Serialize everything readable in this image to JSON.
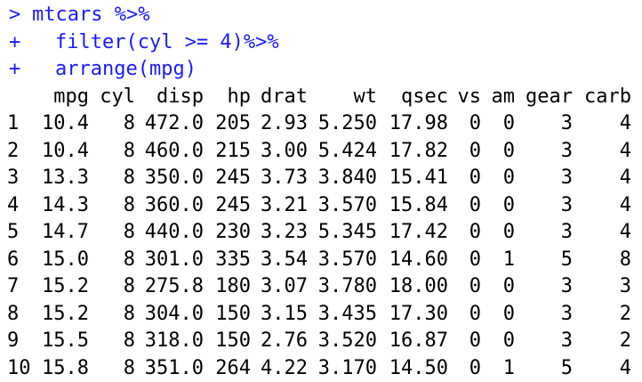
{
  "colors": {
    "command": "#1a1aff",
    "output": "#000000",
    "background": "#ffffff"
  },
  "commands": [
    {
      "prompt": ">",
      "text": "mtcars %>%"
    },
    {
      "prompt": "+",
      "text": "filter(cyl >= 4)%>%"
    },
    {
      "prompt": "+",
      "text": "arrange(mpg)"
    }
  ],
  "table": {
    "headers": [
      "mpg",
      "cyl",
      "disp",
      "hp",
      "drat",
      "wt",
      "qsec",
      "vs",
      "am",
      "gear",
      "carb"
    ],
    "rows": [
      {
        "name": "1",
        "cells": [
          "10.4",
          "8",
          "472.0",
          "205",
          "2.93",
          "5.250",
          "17.98",
          "0",
          "0",
          "3",
          "4"
        ]
      },
      {
        "name": "2",
        "cells": [
          "10.4",
          "8",
          "460.0",
          "215",
          "3.00",
          "5.424",
          "17.82",
          "0",
          "0",
          "3",
          "4"
        ]
      },
      {
        "name": "3",
        "cells": [
          "13.3",
          "8",
          "350.0",
          "245",
          "3.73",
          "3.840",
          "15.41",
          "0",
          "0",
          "3",
          "4"
        ]
      },
      {
        "name": "4",
        "cells": [
          "14.3",
          "8",
          "360.0",
          "245",
          "3.21",
          "3.570",
          "15.84",
          "0",
          "0",
          "3",
          "4"
        ]
      },
      {
        "name": "5",
        "cells": [
          "14.7",
          "8",
          "440.0",
          "230",
          "3.23",
          "5.345",
          "17.42",
          "0",
          "0",
          "3",
          "4"
        ]
      },
      {
        "name": "6",
        "cells": [
          "15.0",
          "8",
          "301.0",
          "335",
          "3.54",
          "3.570",
          "14.60",
          "0",
          "1",
          "5",
          "8"
        ]
      },
      {
        "name": "7",
        "cells": [
          "15.2",
          "8",
          "275.8",
          "180",
          "3.07",
          "3.780",
          "18.00",
          "0",
          "0",
          "3",
          "3"
        ]
      },
      {
        "name": "8",
        "cells": [
          "15.2",
          "8",
          "304.0",
          "150",
          "3.15",
          "3.435",
          "17.30",
          "0",
          "0",
          "3",
          "2"
        ]
      },
      {
        "name": "9",
        "cells": [
          "15.5",
          "8",
          "318.0",
          "150",
          "2.76",
          "3.520",
          "16.87",
          "0",
          "0",
          "3",
          "2"
        ]
      },
      {
        "name": "10",
        "cells": [
          "15.8",
          "8",
          "351.0",
          "264",
          "4.22",
          "3.170",
          "14.50",
          "0",
          "1",
          "5",
          "4"
        ]
      }
    ]
  }
}
